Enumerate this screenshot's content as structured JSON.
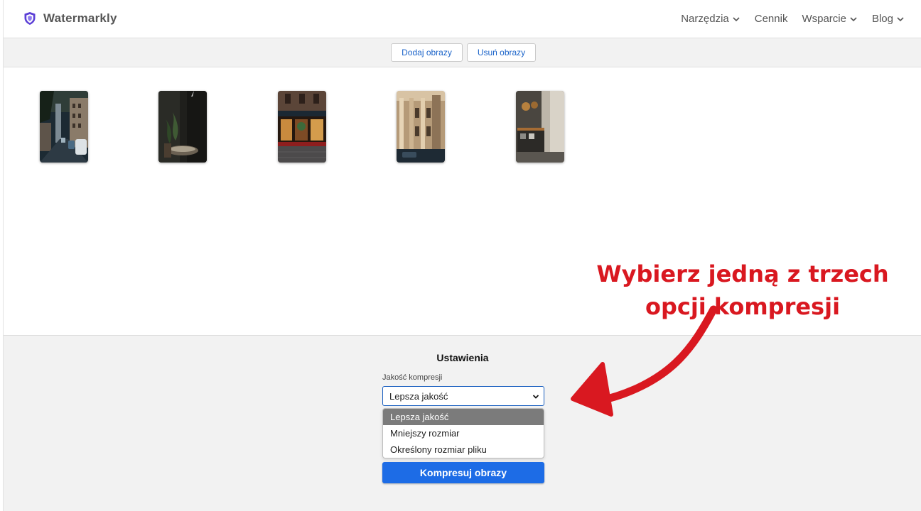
{
  "header": {
    "logo_text": "Watermarkly",
    "nav": [
      {
        "label": "Narzędzia",
        "has_dropdown": true
      },
      {
        "label": "Cennik",
        "has_dropdown": false
      },
      {
        "label": "Wsparcie",
        "has_dropdown": true
      },
      {
        "label": "Blog",
        "has_dropdown": true
      }
    ]
  },
  "toolbar": {
    "add_label": "Dodaj obrazy",
    "remove_label": "Usuń obrazy"
  },
  "gallery": {
    "thumbnails": [
      "street",
      "interior-plants",
      "shop-front",
      "building-facade",
      "cafe-interior"
    ]
  },
  "annotation": {
    "line1": "Wybierz jedną z trzech",
    "line2": "opcji kompresji",
    "color": "#d91820"
  },
  "settings": {
    "title": "Ustawienia",
    "quality_label": "Jakość kompresji",
    "selected": "Lepsza jakość",
    "options": [
      "Lepsza jakość",
      "Mniejszy rozmiar",
      "Określony rozmiar pliku"
    ],
    "compress_label": "Kompresuj obrazy"
  },
  "colors": {
    "accent": "#1d6ce6",
    "link": "#1a63c9",
    "logo": "#5b3fd6"
  }
}
